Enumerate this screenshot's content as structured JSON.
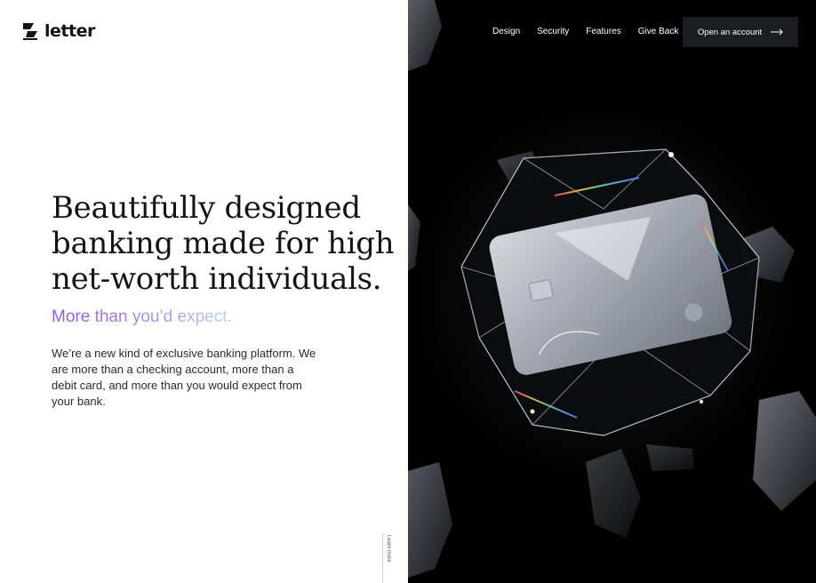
{
  "brand": {
    "name": "letter"
  },
  "nav": {
    "items": [
      "Design",
      "Security",
      "Features",
      "Give Back"
    ]
  },
  "cta": {
    "label": "Open an account"
  },
  "hero": {
    "headline_lines": [
      "Beautifully designed",
      "banking made for high",
      "net-worth individuals."
    ],
    "subhead": "More than you’d expect.",
    "body": "We’re a new kind of exclusive banking platform. We are more than a checking account, more than a debit card, and more than you would expect from your bank."
  },
  "scroll_hint": {
    "label": "Learn more"
  },
  "colors": {
    "brand_text": "#141414",
    "subhead_gradient_start": "#8a5ae0",
    "subhead_gradient_end": "#b9d3ef",
    "cta_background": "#1b1e22",
    "hero_panel_background": "#000000"
  },
  "icons": {
    "logo": "letter-logo-icon",
    "cta_arrow": "arrow-right-icon",
    "hero_art": "crystal-card-illustration"
  }
}
